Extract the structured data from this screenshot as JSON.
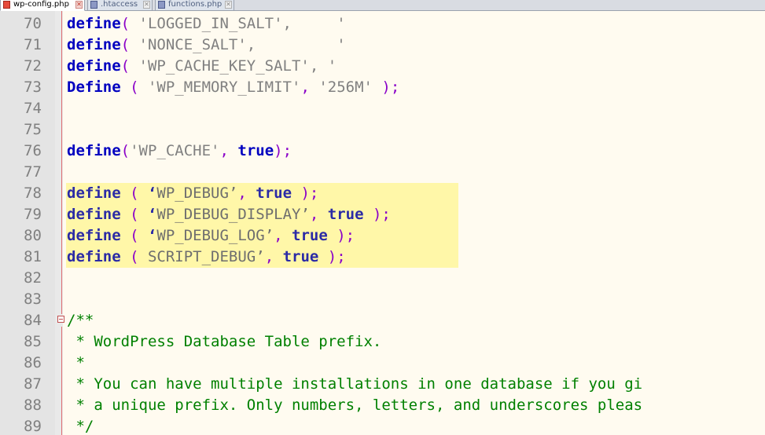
{
  "tabs": [
    {
      "label": "wp-config.php",
      "active": true
    },
    {
      "label": ".htaccess",
      "active": false
    },
    {
      "label": "functions.php",
      "active": false
    }
  ],
  "editor": {
    "highlighted_lines": [
      78,
      79,
      80,
      81
    ],
    "fold_line": 84,
    "lines": [
      {
        "n": "70",
        "t": [
          [
            "kw",
            "define"
          ],
          [
            "op",
            "( "
          ],
          [
            "str",
            "'LOGGED_IN_SALT',     '"
          ]
        ]
      },
      {
        "n": "71",
        "t": [
          [
            "kw",
            "define"
          ],
          [
            "op",
            "( "
          ],
          [
            "str",
            "'NONCE_SALT',         '"
          ]
        ]
      },
      {
        "n": "72",
        "t": [
          [
            "kw",
            "define"
          ],
          [
            "op",
            "( "
          ],
          [
            "str",
            "'WP_CACHE_KEY_SALT', '"
          ]
        ]
      },
      {
        "n": "73",
        "t": [
          [
            "kw",
            "Define"
          ],
          [
            "op",
            " ( "
          ],
          [
            "str",
            "'WP_MEMORY_LIMIT'"
          ],
          [
            "op",
            ", "
          ],
          [
            "str",
            "'256M'"
          ],
          [
            "op",
            " );"
          ]
        ]
      },
      {
        "n": "74",
        "t": []
      },
      {
        "n": "75",
        "t": []
      },
      {
        "n": "76",
        "t": [
          [
            "kw",
            "define"
          ],
          [
            "op",
            "("
          ],
          [
            "str",
            "'WP_CACHE'"
          ],
          [
            "op",
            ", "
          ],
          [
            "kw",
            "true"
          ],
          [
            "op",
            ");"
          ]
        ]
      },
      {
        "n": "77",
        "t": []
      },
      {
        "n": "78",
        "t": [
          [
            "kw2",
            "define"
          ],
          [
            "op",
            " ( "
          ],
          [
            "kw2",
            "‘"
          ],
          [
            "str2",
            "WP_DEBUG’"
          ],
          [
            "op",
            ", "
          ],
          [
            "kw2",
            "true"
          ],
          [
            "op",
            " );"
          ]
        ]
      },
      {
        "n": "79",
        "t": [
          [
            "kw2",
            "define"
          ],
          [
            "op",
            " ( "
          ],
          [
            "kw2",
            "‘"
          ],
          [
            "str2",
            "WP_DEBUG_DISPLAY’"
          ],
          [
            "op",
            ", "
          ],
          [
            "kw2",
            "true"
          ],
          [
            "op",
            " );"
          ]
        ]
      },
      {
        "n": "80",
        "t": [
          [
            "kw2",
            "define"
          ],
          [
            "op",
            " ( "
          ],
          [
            "kw2",
            "‘"
          ],
          [
            "str2",
            "WP_DEBUG_LOG’"
          ],
          [
            "op",
            ", "
          ],
          [
            "kw2",
            "true"
          ],
          [
            "op",
            " );"
          ]
        ]
      },
      {
        "n": "81",
        "t": [
          [
            "kw2",
            "define"
          ],
          [
            "op",
            " ( "
          ],
          [
            "str2",
            "SCRIPT_DEBUG’"
          ],
          [
            "op",
            ", "
          ],
          [
            "kw2",
            "true"
          ],
          [
            "op",
            " );"
          ]
        ]
      },
      {
        "n": "82",
        "t": []
      },
      {
        "n": "83",
        "t": []
      },
      {
        "n": "84",
        "t": [
          [
            "cm",
            "/**"
          ]
        ]
      },
      {
        "n": "85",
        "t": [
          [
            "cm",
            " * WordPress Database Table prefix."
          ]
        ]
      },
      {
        "n": "86",
        "t": [
          [
            "cm",
            " *"
          ]
        ]
      },
      {
        "n": "87",
        "t": [
          [
            "cm",
            " * You can have multiple installations in one database if you gi"
          ]
        ]
      },
      {
        "n": "88",
        "t": [
          [
            "cm",
            " * a unique prefix. Only numbers, letters, and underscores pleas"
          ]
        ]
      },
      {
        "n": "89",
        "t": [
          [
            "cm",
            " */"
          ]
        ]
      }
    ]
  }
}
